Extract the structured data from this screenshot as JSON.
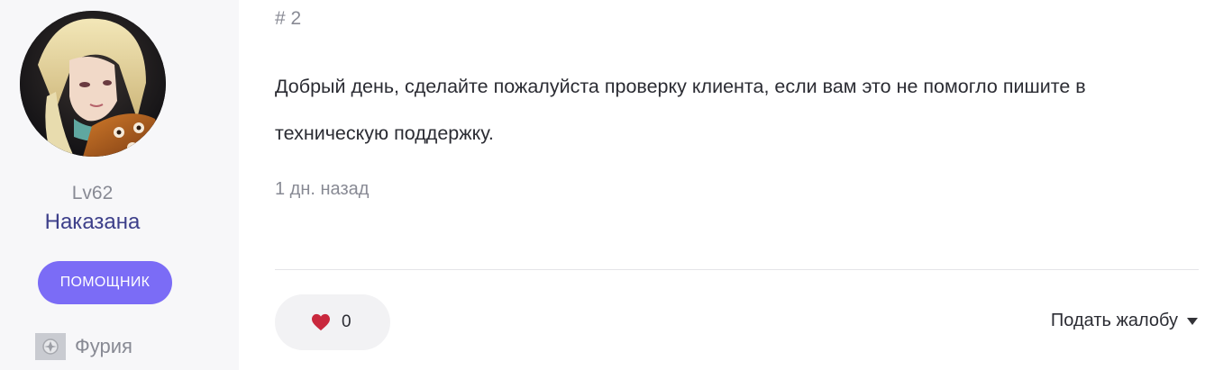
{
  "author": {
    "level": "Lv62",
    "status": "Наказана",
    "role": "ПОМОЩНИК",
    "class_name": "Фурия",
    "avatar_icon": "avatar-portrait"
  },
  "post": {
    "number": "# 2",
    "body": "Добрый день, сделайте пожалуйста проверку клиента, если вам это не помогло пишите в техническую поддержку.",
    "time": "1 дн. назад"
  },
  "actions": {
    "like_icon": "heart-icon",
    "like_count": "0",
    "report_label": "Подать жалобу",
    "report_icon": "caret-down-icon"
  },
  "colors": {
    "role_badge": "#7b6cf6",
    "status_text": "#3d3f8a",
    "heart": "#c9283d",
    "sidebar_bg": "#f7f7f9"
  }
}
